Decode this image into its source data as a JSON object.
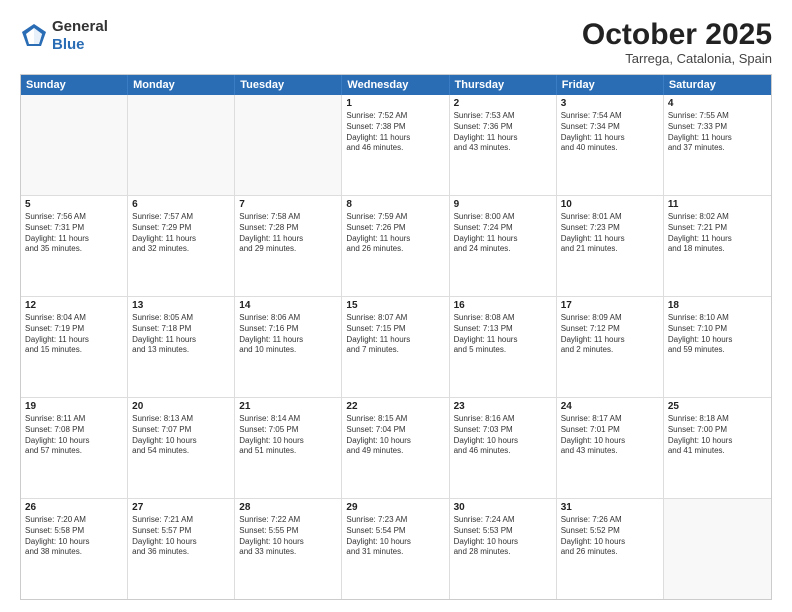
{
  "logo": {
    "general": "General",
    "blue": "Blue"
  },
  "header": {
    "month": "October 2025",
    "location": "Tarrega, Catalonia, Spain"
  },
  "weekdays": [
    "Sunday",
    "Monday",
    "Tuesday",
    "Wednesday",
    "Thursday",
    "Friday",
    "Saturday"
  ],
  "rows": [
    [
      {
        "day": "",
        "info": "",
        "empty": true
      },
      {
        "day": "",
        "info": "",
        "empty": true
      },
      {
        "day": "",
        "info": "",
        "empty": true
      },
      {
        "day": "1",
        "info": "Sunrise: 7:52 AM\nSunset: 7:38 PM\nDaylight: 11 hours\nand 46 minutes.",
        "empty": false
      },
      {
        "day": "2",
        "info": "Sunrise: 7:53 AM\nSunset: 7:36 PM\nDaylight: 11 hours\nand 43 minutes.",
        "empty": false
      },
      {
        "day": "3",
        "info": "Sunrise: 7:54 AM\nSunset: 7:34 PM\nDaylight: 11 hours\nand 40 minutes.",
        "empty": false
      },
      {
        "day": "4",
        "info": "Sunrise: 7:55 AM\nSunset: 7:33 PM\nDaylight: 11 hours\nand 37 minutes.",
        "empty": false
      }
    ],
    [
      {
        "day": "5",
        "info": "Sunrise: 7:56 AM\nSunset: 7:31 PM\nDaylight: 11 hours\nand 35 minutes.",
        "empty": false
      },
      {
        "day": "6",
        "info": "Sunrise: 7:57 AM\nSunset: 7:29 PM\nDaylight: 11 hours\nand 32 minutes.",
        "empty": false
      },
      {
        "day": "7",
        "info": "Sunrise: 7:58 AM\nSunset: 7:28 PM\nDaylight: 11 hours\nand 29 minutes.",
        "empty": false
      },
      {
        "day": "8",
        "info": "Sunrise: 7:59 AM\nSunset: 7:26 PM\nDaylight: 11 hours\nand 26 minutes.",
        "empty": false
      },
      {
        "day": "9",
        "info": "Sunrise: 8:00 AM\nSunset: 7:24 PM\nDaylight: 11 hours\nand 24 minutes.",
        "empty": false
      },
      {
        "day": "10",
        "info": "Sunrise: 8:01 AM\nSunset: 7:23 PM\nDaylight: 11 hours\nand 21 minutes.",
        "empty": false
      },
      {
        "day": "11",
        "info": "Sunrise: 8:02 AM\nSunset: 7:21 PM\nDaylight: 11 hours\nand 18 minutes.",
        "empty": false
      }
    ],
    [
      {
        "day": "12",
        "info": "Sunrise: 8:04 AM\nSunset: 7:19 PM\nDaylight: 11 hours\nand 15 minutes.",
        "empty": false
      },
      {
        "day": "13",
        "info": "Sunrise: 8:05 AM\nSunset: 7:18 PM\nDaylight: 11 hours\nand 13 minutes.",
        "empty": false
      },
      {
        "day": "14",
        "info": "Sunrise: 8:06 AM\nSunset: 7:16 PM\nDaylight: 11 hours\nand 10 minutes.",
        "empty": false
      },
      {
        "day": "15",
        "info": "Sunrise: 8:07 AM\nSunset: 7:15 PM\nDaylight: 11 hours\nand 7 minutes.",
        "empty": false
      },
      {
        "day": "16",
        "info": "Sunrise: 8:08 AM\nSunset: 7:13 PM\nDaylight: 11 hours\nand 5 minutes.",
        "empty": false
      },
      {
        "day": "17",
        "info": "Sunrise: 8:09 AM\nSunset: 7:12 PM\nDaylight: 11 hours\nand 2 minutes.",
        "empty": false
      },
      {
        "day": "18",
        "info": "Sunrise: 8:10 AM\nSunset: 7:10 PM\nDaylight: 10 hours\nand 59 minutes.",
        "empty": false
      }
    ],
    [
      {
        "day": "19",
        "info": "Sunrise: 8:11 AM\nSunset: 7:08 PM\nDaylight: 10 hours\nand 57 minutes.",
        "empty": false
      },
      {
        "day": "20",
        "info": "Sunrise: 8:13 AM\nSunset: 7:07 PM\nDaylight: 10 hours\nand 54 minutes.",
        "empty": false
      },
      {
        "day": "21",
        "info": "Sunrise: 8:14 AM\nSunset: 7:05 PM\nDaylight: 10 hours\nand 51 minutes.",
        "empty": false
      },
      {
        "day": "22",
        "info": "Sunrise: 8:15 AM\nSunset: 7:04 PM\nDaylight: 10 hours\nand 49 minutes.",
        "empty": false
      },
      {
        "day": "23",
        "info": "Sunrise: 8:16 AM\nSunset: 7:03 PM\nDaylight: 10 hours\nand 46 minutes.",
        "empty": false
      },
      {
        "day": "24",
        "info": "Sunrise: 8:17 AM\nSunset: 7:01 PM\nDaylight: 10 hours\nand 43 minutes.",
        "empty": false
      },
      {
        "day": "25",
        "info": "Sunrise: 8:18 AM\nSunset: 7:00 PM\nDaylight: 10 hours\nand 41 minutes.",
        "empty": false
      }
    ],
    [
      {
        "day": "26",
        "info": "Sunrise: 7:20 AM\nSunset: 5:58 PM\nDaylight: 10 hours\nand 38 minutes.",
        "empty": false
      },
      {
        "day": "27",
        "info": "Sunrise: 7:21 AM\nSunset: 5:57 PM\nDaylight: 10 hours\nand 36 minutes.",
        "empty": false
      },
      {
        "day": "28",
        "info": "Sunrise: 7:22 AM\nSunset: 5:55 PM\nDaylight: 10 hours\nand 33 minutes.",
        "empty": false
      },
      {
        "day": "29",
        "info": "Sunrise: 7:23 AM\nSunset: 5:54 PM\nDaylight: 10 hours\nand 31 minutes.",
        "empty": false
      },
      {
        "day": "30",
        "info": "Sunrise: 7:24 AM\nSunset: 5:53 PM\nDaylight: 10 hours\nand 28 minutes.",
        "empty": false
      },
      {
        "day": "31",
        "info": "Sunrise: 7:26 AM\nSunset: 5:52 PM\nDaylight: 10 hours\nand 26 minutes.",
        "empty": false
      },
      {
        "day": "",
        "info": "",
        "empty": true
      }
    ]
  ]
}
